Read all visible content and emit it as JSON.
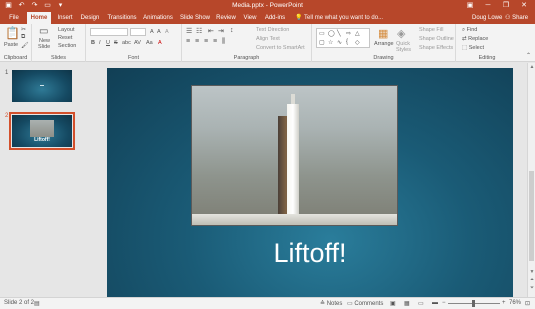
{
  "window": {
    "title": "Media.pptx - PowerPoint",
    "qat": [
      "save-icon",
      "undo-icon",
      "redo-icon",
      "start-icon",
      "more-icon"
    ],
    "controls": [
      "minimize-icon",
      "restore-icon",
      "close-icon"
    ]
  },
  "tabs": [
    {
      "label": "File"
    },
    {
      "label": "Home"
    },
    {
      "label": "Insert"
    },
    {
      "label": "Design"
    },
    {
      "label": "Transitions"
    },
    {
      "label": "Animations"
    },
    {
      "label": "Slide Show"
    },
    {
      "label": "Review"
    },
    {
      "label": "View"
    },
    {
      "label": "Add-ins"
    }
  ],
  "active_tab": "Home",
  "tellme": {
    "placeholder": "Tell me what you want to do..."
  },
  "user": {
    "name": "Doug Lowe"
  },
  "share_label": "Share",
  "ribbon": {
    "clipboard": {
      "label": "Clipboard",
      "paste": "Paste"
    },
    "slides": {
      "label": "Slides",
      "new_slide": "New",
      "new_slide_2": "Slide",
      "layout": "Layout",
      "reset": "Reset",
      "section": "Section"
    },
    "font": {
      "label": "Font",
      "bold": "B",
      "italic": "I",
      "underline": "U",
      "strike": "S",
      "shadow": "abc",
      "spacing": "AV",
      "case": "Aa",
      "grow": "A",
      "shrink": "A",
      "clear": "A",
      "color": "A"
    },
    "paragraph": {
      "label": "Paragraph",
      "text_direction": "Text Direction",
      "align_text": "Align Text",
      "convert_smartart": "Convert to SmartArt"
    },
    "drawing": {
      "label": "Drawing",
      "arrange": "Arrange",
      "quick_styles": "Quick",
      "quick_styles_2": "Styles",
      "shape_fill": "Shape Fill",
      "shape_outline": "Shape Outline",
      "shape_effects": "Shape Effects"
    },
    "editing": {
      "label": "Editing",
      "find": "Find",
      "replace": "Replace",
      "select": "Select"
    }
  },
  "thumbnails": [
    {
      "number": "1",
      "text": ""
    },
    {
      "number": "2",
      "text": "Liftoff!"
    }
  ],
  "slide": {
    "title": "Liftoff!"
  },
  "status": {
    "slide_info": "Slide 2 of 2",
    "notes": "Notes",
    "comments": "Comments",
    "zoom": "76%"
  }
}
